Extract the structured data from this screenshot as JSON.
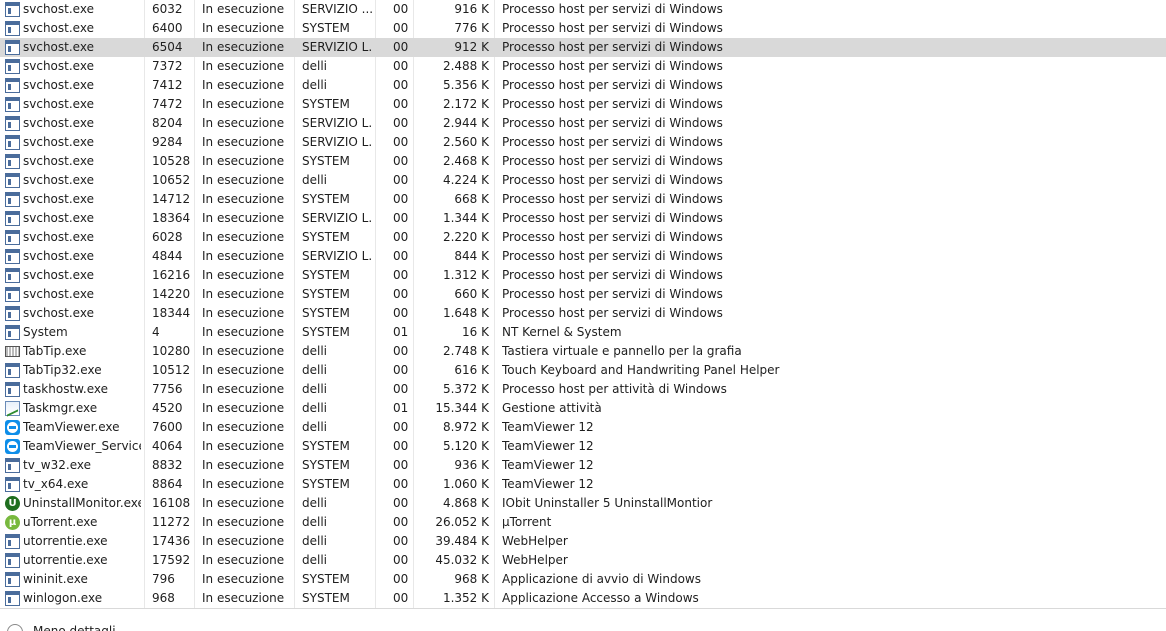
{
  "selected_row_index": 2,
  "rows": [
    {
      "icon": "window-app-icon",
      "name": "svchost.exe",
      "pid": "6032",
      "status": "In esecuzione",
      "user": "SERVIZIO ...",
      "cpu": "00",
      "memory": "916 K",
      "description": "Processo host per servizi di Windows"
    },
    {
      "icon": "window-app-icon",
      "name": "svchost.exe",
      "pid": "6400",
      "status": "In esecuzione",
      "user": "SYSTEM",
      "cpu": "00",
      "memory": "776 K",
      "description": "Processo host per servizi di Windows"
    },
    {
      "icon": "window-app-icon",
      "name": "svchost.exe",
      "pid": "6504",
      "status": "In esecuzione",
      "user": "SERVIZIO L...",
      "cpu": "00",
      "memory": "912 K",
      "description": "Processo host per servizi di Windows"
    },
    {
      "icon": "window-app-icon",
      "name": "svchost.exe",
      "pid": "7372",
      "status": "In esecuzione",
      "user": "delli",
      "cpu": "00",
      "memory": "2.488 K",
      "description": "Processo host per servizi di Windows"
    },
    {
      "icon": "window-app-icon",
      "name": "svchost.exe",
      "pid": "7412",
      "status": "In esecuzione",
      "user": "delli",
      "cpu": "00",
      "memory": "5.356 K",
      "description": "Processo host per servizi di Windows"
    },
    {
      "icon": "window-app-icon",
      "name": "svchost.exe",
      "pid": "7472",
      "status": "In esecuzione",
      "user": "SYSTEM",
      "cpu": "00",
      "memory": "2.172 K",
      "description": "Processo host per servizi di Windows"
    },
    {
      "icon": "window-app-icon",
      "name": "svchost.exe",
      "pid": "8204",
      "status": "In esecuzione",
      "user": "SERVIZIO L...",
      "cpu": "00",
      "memory": "2.944 K",
      "description": "Processo host per servizi di Windows"
    },
    {
      "icon": "window-app-icon",
      "name": "svchost.exe",
      "pid": "9284",
      "status": "In esecuzione",
      "user": "SERVIZIO L...",
      "cpu": "00",
      "memory": "2.560 K",
      "description": "Processo host per servizi di Windows"
    },
    {
      "icon": "window-app-icon",
      "name": "svchost.exe",
      "pid": "10528",
      "status": "In esecuzione",
      "user": "SYSTEM",
      "cpu": "00",
      "memory": "2.468 K",
      "description": "Processo host per servizi di Windows"
    },
    {
      "icon": "window-app-icon",
      "name": "svchost.exe",
      "pid": "10652",
      "status": "In esecuzione",
      "user": "delli",
      "cpu": "00",
      "memory": "4.224 K",
      "description": "Processo host per servizi di Windows"
    },
    {
      "icon": "window-app-icon",
      "name": "svchost.exe",
      "pid": "14712",
      "status": "In esecuzione",
      "user": "SYSTEM",
      "cpu": "00",
      "memory": "668 K",
      "description": "Processo host per servizi di Windows"
    },
    {
      "icon": "window-app-icon",
      "name": "svchost.exe",
      "pid": "18364",
      "status": "In esecuzione",
      "user": "SERVIZIO L...",
      "cpu": "00",
      "memory": "1.344 K",
      "description": "Processo host per servizi di Windows"
    },
    {
      "icon": "window-app-icon",
      "name": "svchost.exe",
      "pid": "6028",
      "status": "In esecuzione",
      "user": "SYSTEM",
      "cpu": "00",
      "memory": "2.220 K",
      "description": "Processo host per servizi di Windows"
    },
    {
      "icon": "window-app-icon",
      "name": "svchost.exe",
      "pid": "4844",
      "status": "In esecuzione",
      "user": "SERVIZIO L...",
      "cpu": "00",
      "memory": "844 K",
      "description": "Processo host per servizi di Windows"
    },
    {
      "icon": "window-app-icon",
      "name": "svchost.exe",
      "pid": "16216",
      "status": "In esecuzione",
      "user": "SYSTEM",
      "cpu": "00",
      "memory": "1.312 K",
      "description": "Processo host per servizi di Windows"
    },
    {
      "icon": "window-app-icon",
      "name": "svchost.exe",
      "pid": "14220",
      "status": "In esecuzione",
      "user": "SYSTEM",
      "cpu": "00",
      "memory": "660 K",
      "description": "Processo host per servizi di Windows"
    },
    {
      "icon": "window-app-icon",
      "name": "svchost.exe",
      "pid": "18344",
      "status": "In esecuzione",
      "user": "SYSTEM",
      "cpu": "00",
      "memory": "1.648 K",
      "description": "Processo host per servizi di Windows"
    },
    {
      "icon": "window-app-icon",
      "name": "System",
      "pid": "4",
      "status": "In esecuzione",
      "user": "SYSTEM",
      "cpu": "01",
      "memory": "16 K",
      "description": "NT Kernel & System"
    },
    {
      "icon": "keyboard-icon",
      "name": "TabTip.exe",
      "pid": "10280",
      "status": "In esecuzione",
      "user": "delli",
      "cpu": "00",
      "memory": "2.748 K",
      "description": "Tastiera virtuale e pannello per la grafia"
    },
    {
      "icon": "window-app-icon",
      "name": "TabTip32.exe",
      "pid": "10512",
      "status": "In esecuzione",
      "user": "delli",
      "cpu": "00",
      "memory": "616 K",
      "description": "Touch Keyboard and Handwriting Panel Helper"
    },
    {
      "icon": "window-app-icon",
      "name": "taskhostw.exe",
      "pid": "7756",
      "status": "In esecuzione",
      "user": "delli",
      "cpu": "00",
      "memory": "5.372 K",
      "description": "Processo host per attività di Windows"
    },
    {
      "icon": "task-manager-icon",
      "name": "Taskmgr.exe",
      "pid": "4520",
      "status": "In esecuzione",
      "user": "delli",
      "cpu": "01",
      "memory": "15.344 K",
      "description": "Gestione attività"
    },
    {
      "icon": "teamviewer-icon",
      "name": "TeamViewer.exe",
      "pid": "7600",
      "status": "In esecuzione",
      "user": "delli",
      "cpu": "00",
      "memory": "8.972 K",
      "description": "TeamViewer 12"
    },
    {
      "icon": "teamviewer-icon",
      "name": "TeamViewer_Service....",
      "pid": "4064",
      "status": "In esecuzione",
      "user": "SYSTEM",
      "cpu": "00",
      "memory": "5.120 K",
      "description": "TeamViewer 12"
    },
    {
      "icon": "window-app-icon",
      "name": "tv_w32.exe",
      "pid": "8832",
      "status": "In esecuzione",
      "user": "SYSTEM",
      "cpu": "00",
      "memory": "936 K",
      "description": "TeamViewer 12"
    },
    {
      "icon": "window-app-icon",
      "name": "tv_x64.exe",
      "pid": "8864",
      "status": "In esecuzione",
      "user": "SYSTEM",
      "cpu": "00",
      "memory": "1.060 K",
      "description": "TeamViewer 12"
    },
    {
      "icon": "iobit-uninstaller-icon",
      "name": "UninstallMonitor.exe",
      "pid": "16108",
      "status": "In esecuzione",
      "user": "delli",
      "cpu": "00",
      "memory": "4.868 K",
      "description": "IObit Uninstaller 5 UninstallMontior"
    },
    {
      "icon": "utorrent-icon",
      "name": "uTorrent.exe",
      "pid": "11272",
      "status": "In esecuzione",
      "user": "delli",
      "cpu": "00",
      "memory": "26.052 K",
      "description": "µTorrent"
    },
    {
      "icon": "window-app-icon",
      "name": "utorrentie.exe",
      "pid": "17436",
      "status": "In esecuzione",
      "user": "delli",
      "cpu": "00",
      "memory": "39.484 K",
      "description": "WebHelper"
    },
    {
      "icon": "window-app-icon",
      "name": "utorrentie.exe",
      "pid": "17592",
      "status": "In esecuzione",
      "user": "delli",
      "cpu": "00",
      "memory": "45.032 K",
      "description": "WebHelper"
    },
    {
      "icon": "window-app-icon",
      "name": "wininit.exe",
      "pid": "796",
      "status": "In esecuzione",
      "user": "SYSTEM",
      "cpu": "00",
      "memory": "968 K",
      "description": "Applicazione di avvio di Windows"
    },
    {
      "icon": "window-app-icon",
      "name": "winlogon.exe",
      "pid": "968",
      "status": "In esecuzione",
      "user": "SYSTEM",
      "cpu": "00",
      "memory": "1.352 K",
      "description": "Applicazione Accesso a Windows"
    }
  ],
  "footer": {
    "icon": "chevron-up-icon",
    "label": "Meno dettagli"
  },
  "colors": {
    "selected_row": "#d9d9d9",
    "grid_line": "#e8e8e8"
  }
}
